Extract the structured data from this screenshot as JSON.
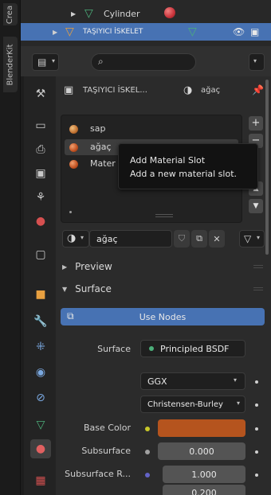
{
  "side_tabs": [
    "Crea",
    "BlenderKit"
  ],
  "outliner": {
    "rows": [
      {
        "name": "Cylinder",
        "icon": "mesh-data-icon",
        "right_icon": "material-icon"
      },
      {
        "name": "TAŞIYICI İSKELET",
        "icon": "mesh-data-icon",
        "right_icon": "mesh-data-icon"
      }
    ]
  },
  "header": {
    "search_icon": "search-icon"
  },
  "properties": {
    "object_name": "TAŞIYICI İSKEL...",
    "material_name_header": "ağaç",
    "slots": [
      "sap",
      "ağaç",
      "Mater"
    ],
    "tooltip": {
      "title": "Add Material Slot",
      "desc": "Add a new material slot."
    },
    "material_field": "ağaç",
    "panels": {
      "preview": "Preview",
      "surface": "Surface"
    },
    "use_nodes_label": "Use Nodes",
    "surface_label": "Surface",
    "surface_value": "Principled BSDF",
    "distribution": "GGX",
    "subsurface_method": "Christensen-Burley",
    "rows": [
      {
        "label": "Base Color",
        "value": ""
      },
      {
        "label": "Subsurface",
        "value": "0.000"
      },
      {
        "label": "Subsurface R...",
        "value": "1.000"
      },
      {
        "label": "",
        "value": "0.200"
      }
    ]
  },
  "colors": {
    "selection_blue": "#4772b3",
    "base_color_swatch": "#b5541e",
    "use_nodes_blue": "#4772b3",
    "material_green": "#4caf7a",
    "material_red": "#c8323a"
  }
}
